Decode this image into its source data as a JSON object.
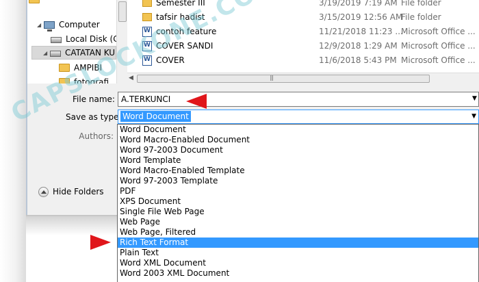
{
  "nav": {
    "items": [
      {
        "label": "Computer",
        "icon": "computer-icon"
      },
      {
        "label": "Local Disk (C:",
        "icon": "drive-icon"
      },
      {
        "label": "CATATAN KU",
        "icon": "drive-icon"
      },
      {
        "label": "AMPIBI",
        "icon": "folder-icon"
      },
      {
        "label": "fotografi",
        "icon": "folder-icon"
      }
    ]
  },
  "files": [
    {
      "name": "Semester III",
      "date": "3/19/2019 7:19 AM",
      "type": "File folder",
      "icon": "folder-icon"
    },
    {
      "name": "tafsir hadist",
      "date": "3/15/2019 12:56 AM",
      "type": "File folder",
      "icon": "folder-icon"
    },
    {
      "name": "contoh feature",
      "date": "11/21/2018 11:23 ...",
      "type": "Microsoft Office ...",
      "icon": "word-doc-icon"
    },
    {
      "name": "COVER SANDI",
      "date": "12/9/2018 1:29 AM",
      "type": "Microsoft Office ...",
      "icon": "word-doc-icon"
    },
    {
      "name": "COVER",
      "date": "11/6/2018 5:43 PM",
      "type": "Microsoft Office ...",
      "icon": "word-doc-icon"
    }
  ],
  "form": {
    "file_name_label": "File name:",
    "file_name_value": "A.TERKUNCI",
    "save_as_type_label": "Save as type:",
    "save_as_type_value": "Word Document",
    "authors_label": "Authors:"
  },
  "save_types": [
    "Word Document",
    "Word Macro-Enabled Document",
    "Word 97-2003 Document",
    "Word Template",
    "Word Macro-Enabled Template",
    "Word 97-2003 Template",
    "PDF",
    "XPS Document",
    "Single File Web Page",
    "Web Page",
    "Web Page, Filtered",
    "Rich Text Format",
    "Plain Text",
    "Word XML Document",
    "Word 2003 XML Document"
  ],
  "highlighted_type": "Rich Text Format",
  "hide_folders_label": "Hide Folders",
  "watermark": "CAPSLOCKONE.COM",
  "colors": {
    "selection": "#3399ff",
    "annotation_arrow": "#e0161b",
    "watermark": "#78c8d2"
  }
}
